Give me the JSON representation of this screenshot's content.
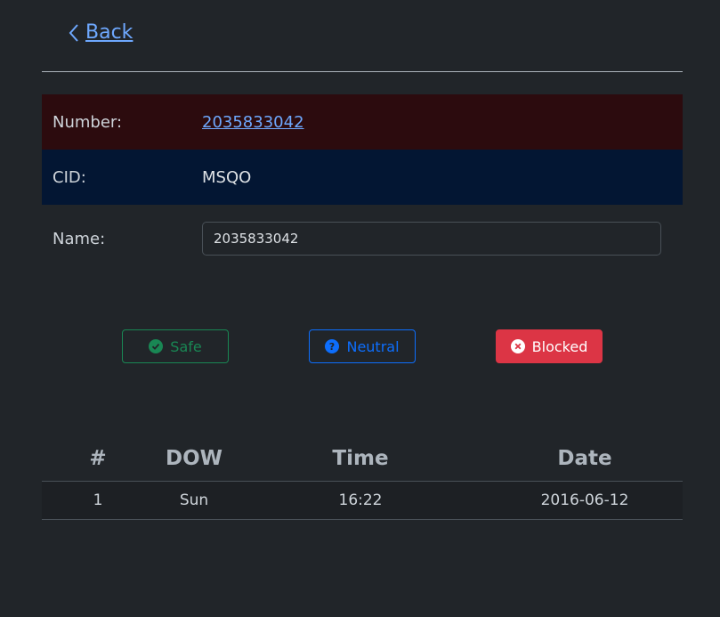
{
  "nav": {
    "back_label": "Back"
  },
  "caller": {
    "number_label": "Number:",
    "number_value": "2035833042",
    "cid_label": "CID:",
    "cid_value": "MSQO",
    "name_label": "Name:",
    "name_value": "2035833042"
  },
  "actions": {
    "safe_label": "Safe",
    "neutral_label": "Neutral",
    "blocked_label": "Blocked"
  },
  "calls_table": {
    "headers": [
      "#",
      "DOW",
      "Time",
      "Date"
    ],
    "rows": [
      [
        "1",
        "Sun",
        "16:22",
        "2016-06-12"
      ]
    ]
  },
  "colors": {
    "background": "#212529",
    "link": "#6ea8fe",
    "number_row_bg": "#2c0b0e",
    "cid_row_bg": "#031633",
    "safe": "#198754",
    "neutral": "#0d6efd",
    "blocked": "#dc3545"
  },
  "icons": {
    "back": "chevron-left-icon",
    "safe": "check-circle-icon",
    "neutral": "question-circle-icon",
    "blocked": "x-circle-icon"
  }
}
